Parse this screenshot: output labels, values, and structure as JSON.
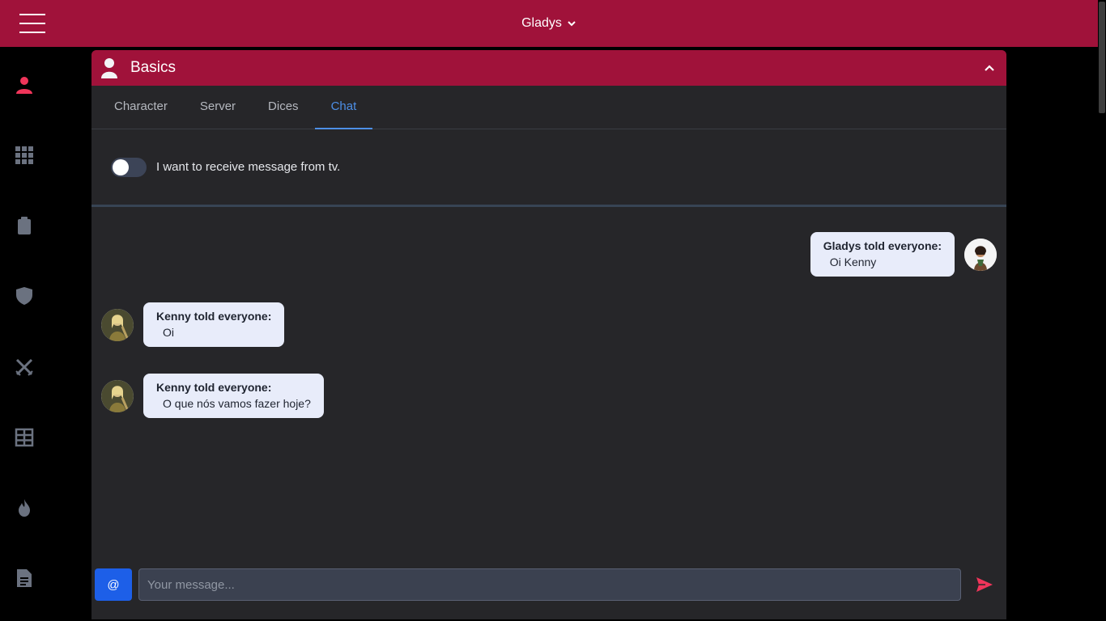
{
  "colors": {
    "brand": "#a0123a",
    "accent": "#4d8fe6",
    "sidebar_active": "#f0355a",
    "sidebar_inactive": "#6b7280",
    "send": "#f0355a"
  },
  "header": {
    "user_name": "Gladys"
  },
  "sidebar": {
    "items": [
      {
        "icon": "user-icon",
        "active": true
      },
      {
        "icon": "grid-icon",
        "active": false
      },
      {
        "icon": "clipboard-icon",
        "active": false
      },
      {
        "icon": "shield-icon",
        "active": false
      },
      {
        "icon": "crossed-swords-icon",
        "active": false
      },
      {
        "icon": "table-icon",
        "active": false
      },
      {
        "icon": "fire-icon",
        "active": false
      },
      {
        "icon": "document-icon",
        "active": false
      }
    ]
  },
  "panel": {
    "title": "Basics",
    "tabs": [
      {
        "label": "Character",
        "active": false
      },
      {
        "label": "Server",
        "active": false
      },
      {
        "label": "Dices",
        "active": false
      },
      {
        "label": "Chat",
        "active": true
      }
    ],
    "toggle": {
      "label": "I want to receive message from tv.",
      "checked": false
    }
  },
  "chat": {
    "messages": [
      {
        "author": "Gladys told everyone:",
        "text": "Oi Kenny",
        "side": "right"
      },
      {
        "author": "Kenny told everyone:",
        "text": "Oi",
        "side": "left"
      },
      {
        "author": "Kenny told everyone:",
        "text": "O que nós vamos fazer hoje?",
        "side": "left"
      }
    ],
    "input": {
      "mention_label": "@",
      "placeholder": "Your message...",
      "value": ""
    }
  }
}
